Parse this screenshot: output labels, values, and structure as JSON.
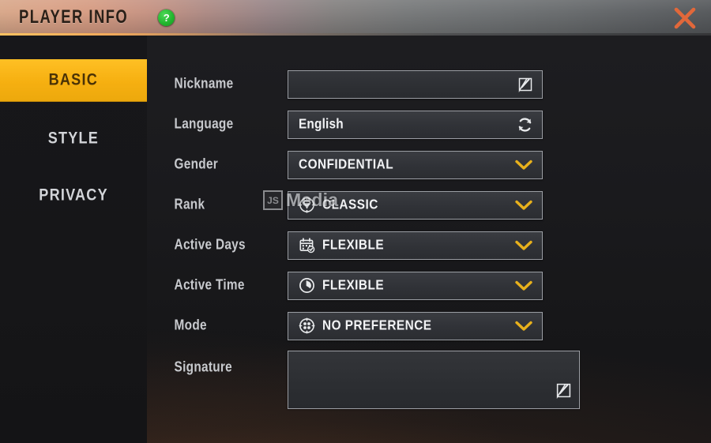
{
  "window": {
    "title": "PLAYER INFO",
    "help_label": "?",
    "close_label": "✕",
    "accent_color": "#f6b011",
    "close_color": "#e2683a",
    "help_color": "#22b72f"
  },
  "sidebar": {
    "items": [
      {
        "label": "BASIC",
        "active": true
      },
      {
        "label": "STYLE",
        "active": false
      },
      {
        "label": "PRIVACY",
        "active": false
      }
    ]
  },
  "form": {
    "rows": [
      {
        "label": "Nickname",
        "value": "",
        "placeholder": "",
        "lead_icon": "",
        "right_icon": "edit-icon"
      },
      {
        "label": "Language",
        "value": "English",
        "lead_icon": "",
        "right_icon": "refresh-icon"
      },
      {
        "label": "Gender",
        "value": "CONFIDENTIAL",
        "lead_icon": "",
        "right_icon": "chevron-down-icon"
      },
      {
        "label": "Rank",
        "value": "CLASSIC",
        "lead_icon": "rank-diamond-icon",
        "right_icon": "chevron-down-icon"
      },
      {
        "label": "Active Days",
        "value": "FLEXIBLE",
        "lead_icon": "calendar-check-icon",
        "right_icon": "chevron-down-icon"
      },
      {
        "label": "Active Time",
        "value": "FLEXIBLE",
        "lead_icon": "clock-icon",
        "right_icon": "chevron-down-icon"
      },
      {
        "label": "Mode",
        "value": "NO PREFERENCE",
        "lead_icon": "mode-dots-icon",
        "right_icon": "chevron-down-icon"
      }
    ],
    "signature": {
      "label": "Signature",
      "value": "",
      "right_icon": "edit-icon"
    }
  },
  "watermark": {
    "logo_text": "JS",
    "text": "Media"
  }
}
